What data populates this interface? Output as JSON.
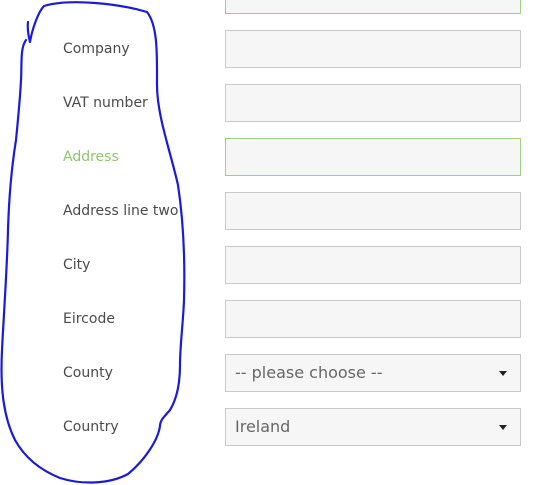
{
  "form": {
    "fields": [
      {
        "label": "Company",
        "type": "text",
        "value": ""
      },
      {
        "label": "VAT number",
        "type": "text",
        "value": ""
      },
      {
        "label": "Address",
        "type": "text",
        "value": "",
        "focused": true
      },
      {
        "label": "Address line two",
        "type": "text",
        "value": ""
      },
      {
        "label": "City",
        "type": "text",
        "value": ""
      },
      {
        "label": "Eircode",
        "type": "text",
        "value": ""
      },
      {
        "label": "County",
        "type": "select",
        "value": "-- please choose --"
      },
      {
        "label": "Country",
        "type": "select",
        "value": "Ireland"
      }
    ]
  },
  "colors": {
    "label_text": "#4a4a4a",
    "active_label": "#8cc86a",
    "focus_border": "#9fd07f",
    "input_background": "#f6f6f6",
    "input_border": "#c9c9c9",
    "annotation_stroke": "#1a1ad8"
  },
  "icons": {
    "select_arrow": "chevron-down-icon"
  }
}
